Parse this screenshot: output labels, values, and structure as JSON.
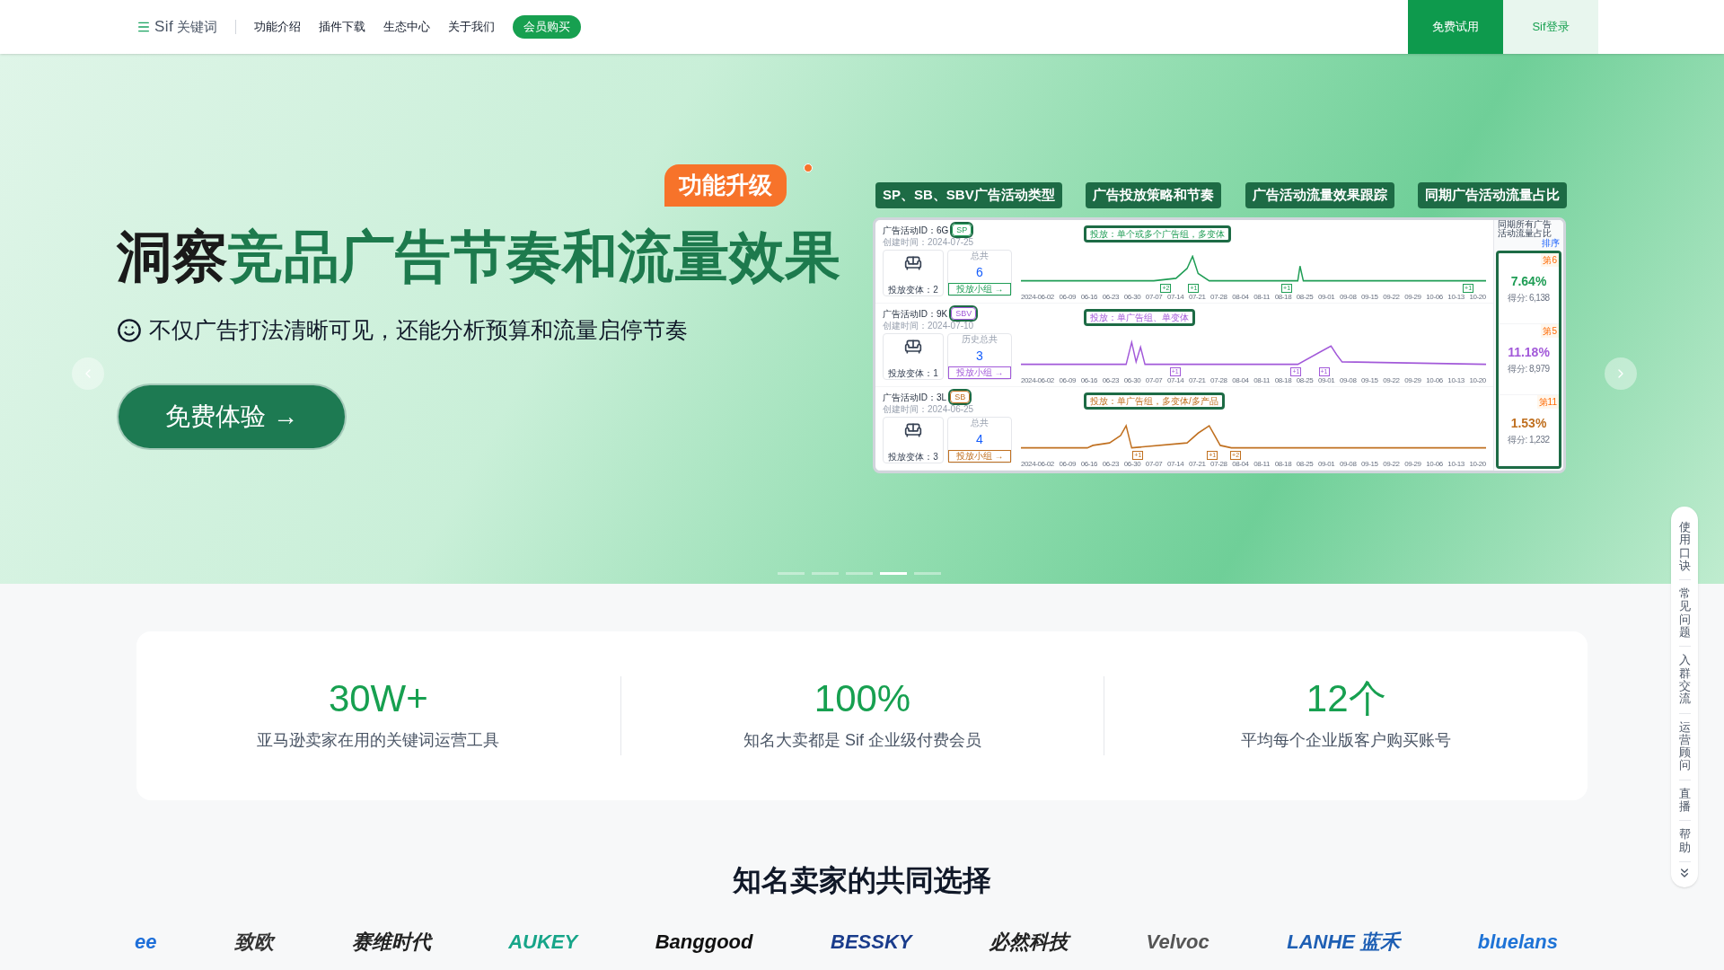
{
  "nav": {
    "logo": "Sif",
    "logo_sub": "关键词",
    "links": [
      {
        "label": "功能介绍"
      },
      {
        "label": "插件下载"
      },
      {
        "label": "生态中心"
      },
      {
        "label": "关于我们"
      }
    ],
    "cta": "会员购买",
    "actions": [
      {
        "label": "免费试用",
        "kind": "primary"
      },
      {
        "label": "Sif登录",
        "kind": "secondary"
      }
    ]
  },
  "hero": {
    "badge": "功能升级",
    "title_dark": "洞察",
    "title_green": "竞品广告节奏和流量效果",
    "subtitle": "不仅广告打法清晰可见，还能分析预算和流量启停节奏",
    "cta": "免费体验 →",
    "feature_labels": [
      "SP、SB、SBV广告活动类型",
      "广告投放策略和节奏",
      "广告活动流量效果跟踪",
      "同期广告活动流量占比"
    ],
    "campaigns": [
      {
        "id": "广告活动ID：6G",
        "type": "SP",
        "color": "#1f9d55",
        "created": "创建时间：2024-07-25",
        "variants": "投放变体：2",
        "count_label": "总共",
        "count": "6",
        "group_link": "投放小组 →",
        "tooltip": "投放：单个或多个广告组，多变体",
        "markers": [
          "+2",
          "+1",
          "+1",
          "+1"
        ],
        "dates": [
          "2024-06-02",
          "06-09",
          "06-16",
          "06-23",
          "06-30",
          "07-07",
          "07-14",
          "07-21",
          "07-28",
          "08-04",
          "08-11",
          "08-18",
          "08-25",
          "09-01",
          "09-08",
          "09-15",
          "09-22",
          "09-29",
          "10-06",
          "10-13",
          "10-20"
        ],
        "rank": "第6",
        "share": "7.64%",
        "score": "得分: 6,138"
      },
      {
        "id": "广告活动ID：9K",
        "type": "SBV",
        "color": "#a259d9",
        "created": "创建时间：2024-07-10",
        "variants": "投放变体：1",
        "count_label": "历史总共",
        "count": "3",
        "group_link": "投放小组 →",
        "tooltip": "投放：单广告组、单变体",
        "markers": [
          "+1",
          "+1",
          "+1"
        ],
        "dates": [
          "2024-06-02",
          "06-09",
          "06-16",
          "06-23",
          "06-30",
          "07-07",
          "07-14",
          "07-21",
          "07-28",
          "08-04",
          "08-11",
          "08-18",
          "08-25",
          "09-01",
          "09-08",
          "09-15",
          "09-22",
          "09-29",
          "10-06",
          "10-13",
          "10-20"
        ],
        "rank": "第5",
        "share": "11.18%",
        "score": "得分: 8,979"
      },
      {
        "id": "广告活动ID：3L",
        "type": "SB",
        "color": "#c07020",
        "created": "创建时间：2024-06-25",
        "variants": "投放变体：3",
        "count_label": "总共",
        "count": "4",
        "group_link": "投放小组 →",
        "tooltip": "投放：单广告组，多变体/多产品",
        "markers": [
          "+1",
          "+1",
          "+2"
        ],
        "dates": [
          "2024-06-02",
          "06-09",
          "06-16",
          "06-23",
          "06-30",
          "07-07",
          "07-14",
          "07-21",
          "07-28",
          "08-04",
          "08-11",
          "08-18",
          "08-25",
          "09-01",
          "09-08",
          "09-15",
          "09-22",
          "09-29",
          "10-06",
          "10-13",
          "10-20"
        ],
        "rank": "第11",
        "share": "1.53%",
        "score": "得分: 1,232"
      }
    ],
    "share_header": "同期所有广告活动流量占比",
    "sort_label": "排序",
    "slides": [
      {
        "selected": false
      },
      {
        "selected": false
      },
      {
        "selected": false
      },
      {
        "selected": true
      },
      {
        "selected": false
      }
    ]
  },
  "stats": [
    {
      "value": "30W+",
      "caption": "亚马逊卖家在用的关键词运营工具"
    },
    {
      "value": "100%",
      "caption": "知名大卖都是 Sif 企业级付费会员"
    },
    {
      "value": "12个",
      "caption": "平均每个企业版客户购买账号"
    }
  ],
  "section_title": "知名卖家的共同选择",
  "logos": [
    {
      "text": "ee",
      "color": "#1e6fd9"
    },
    {
      "text": "致欧",
      "color": "#333333"
    },
    {
      "text": "赛维时代",
      "color": "#222222"
    },
    {
      "text": "AUKEY",
      "color": "#17a589"
    },
    {
      "text": "Banggood",
      "color": "#111111"
    },
    {
      "text": "BESSKY",
      "color": "#1a3c8c"
    },
    {
      "text": "必然科技",
      "color": "#222222"
    },
    {
      "text": "Velvoc",
      "color": "#555555"
    },
    {
      "text": "LANHE 蓝禾",
      "color": "#1e5fb4"
    },
    {
      "text": "bluelans",
      "color": "#1e73d6"
    }
  ],
  "side_panel": [
    "使用口诀",
    "常见问题",
    "入群交流",
    "运营顾问",
    "直播",
    "帮助"
  ]
}
